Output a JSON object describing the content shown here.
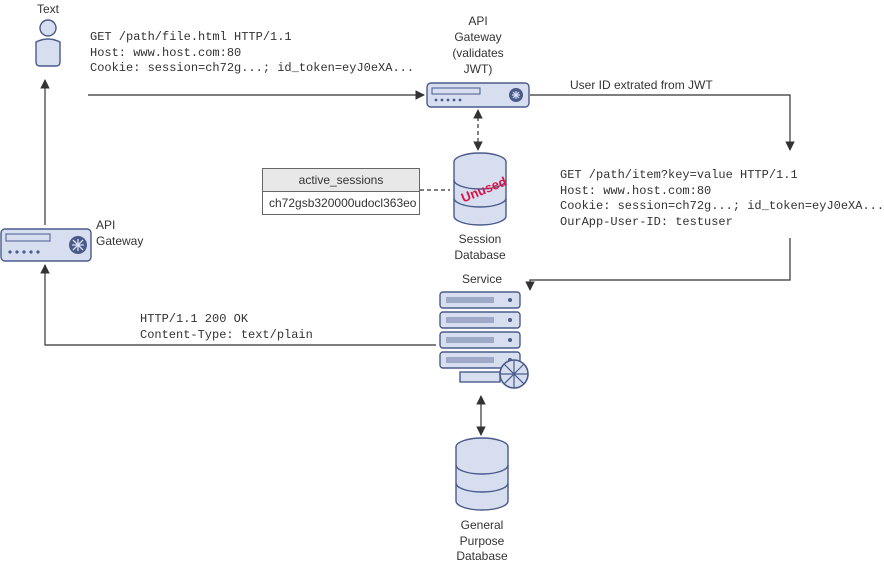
{
  "user_label": "Text",
  "request1": "GET /path/file.html HTTP/1.1\nHost: www.host.com:80\nCookie: session=ch72g...; id_token=eyJ0eXA...",
  "gateway1": {
    "title": "API\nGateway",
    "subtitle": "(validates\nJWT)"
  },
  "edge_extract": "User ID extrated from JWT",
  "session_db": {
    "label": "Session\nDatabase",
    "stamp": "Unused"
  },
  "table": {
    "header": "active_sessions",
    "row": "ch72gsb320000udocl363eo"
  },
  "request2": "GET /path/item?key=value HTTP/1.1\nHost: www.host.com:80\nCookie: session=ch72g...; id_token=eyJ0eXA...\nOurApp-User-ID: testuser",
  "service_label": "Service",
  "general_db_label": "General\nPurpose\nDatabase",
  "response": "HTTP/1.1 200 OK\nContent-Type: text/plain",
  "gateway2": "API\nGateway"
}
